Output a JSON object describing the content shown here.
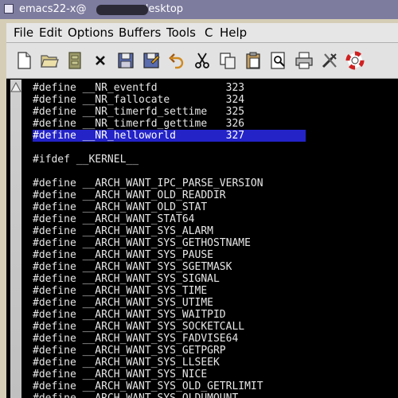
{
  "window": {
    "title_prefix": "emacs22-x@",
    "title_suffix": "-desktop"
  },
  "menu": [
    "File",
    "Edit",
    "Options",
    "Buffers",
    "Tools",
    "C",
    "Help"
  ],
  "toolbar": [
    "new-file-icon",
    "open-folder-icon",
    "dired-icon",
    "close-icon",
    "save-icon",
    "save-as-icon",
    "undo-icon",
    "cut-icon",
    "copy-icon",
    "paste-icon",
    "search-icon",
    "print-icon",
    "preferences-icon",
    "help-icon"
  ],
  "editor": {
    "highlight_color": "#2323c8",
    "lines": [
      "#define __NR_eventfd           323",
      "#define __NR_fallocate         324",
      "#define __NR_timerfd_settime   325",
      "#define __NR_timerfd_gettime   326",
      "#define __NR_helloworld        327",
      "",
      "#ifdef __KERNEL__",
      "",
      "#define __ARCH_WANT_IPC_PARSE_VERSION",
      "#define __ARCH_WANT_OLD_READDIR",
      "#define __ARCH_WANT_OLD_STAT",
      "#define __ARCH_WANT_STAT64",
      "#define __ARCH_WANT_SYS_ALARM",
      "#define __ARCH_WANT_SYS_GETHOSTNAME",
      "#define __ARCH_WANT_SYS_PAUSE",
      "#define __ARCH_WANT_SYS_SGETMASK",
      "#define __ARCH_WANT_SYS_SIGNAL",
      "#define __ARCH_WANT_SYS_TIME",
      "#define __ARCH_WANT_SYS_UTIME",
      "#define __ARCH_WANT_SYS_WAITPID",
      "#define __ARCH_WANT_SYS_SOCKETCALL",
      "#define __ARCH_WANT_SYS_FADVISE64",
      "#define __ARCH_WANT_SYS_GETPGRP",
      "#define __ARCH_WANT_SYS_LLSEEK",
      "#define __ARCH_WANT_SYS_NICE",
      "#define __ARCH_WANT_SYS_OLD_GETRLIMIT",
      "#define __ARCH_WANT_SYS_OLDUMOUNT"
    ],
    "highlighted_index": 4
  }
}
